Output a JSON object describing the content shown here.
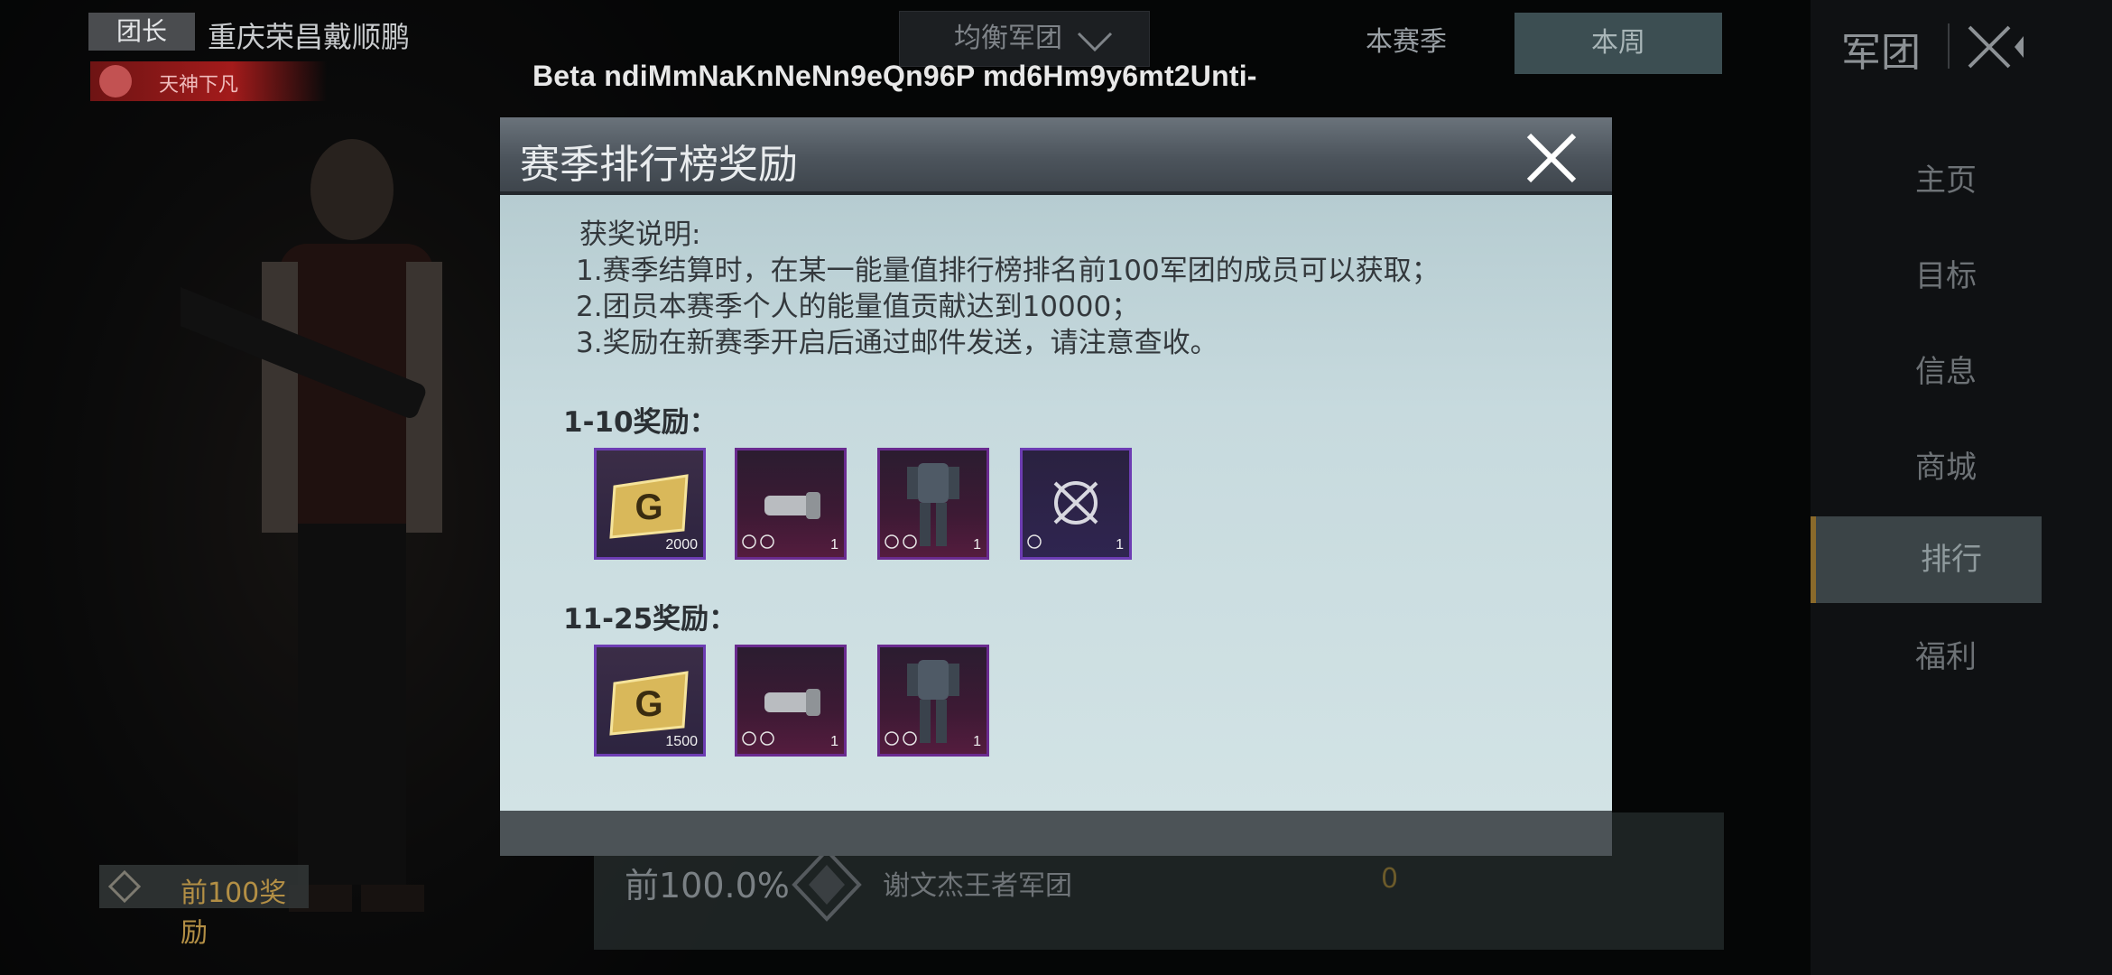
{
  "background": {
    "role_badge": "团长",
    "team_name": "重庆荣昌戴顺鹏",
    "title_ribbon": "天神下凡",
    "center_tab": "均衡军团",
    "season_tab": "本赛季",
    "week_tab": "本周",
    "panel_title": "军团",
    "nav": [
      "主页",
      "目标",
      "信息",
      "商城",
      "排行",
      "福利"
    ],
    "active_nav_index": 4,
    "rank_row": {
      "percent": "前100.0%",
      "team": "谢文杰王者军团",
      "value": "0"
    },
    "bottom_reward_label": "前100奖励"
  },
  "overlay": {
    "beta_watermark": "Beta ndiMmNaKnNeNn9eQn96P md6Hm9y6mt2Unti-"
  },
  "modal": {
    "title": "赛季排行榜奖励",
    "desc_heading": "获奖说明:",
    "desc_lines": [
      "1.赛季结算时，在某一能量值排行榜排名前100军团的成员可以获取；",
      "2.团员本赛季个人的能量值贡献达到10000；",
      "3.奖励在新赛季开启后通过邮件发送，请注意查收。"
    ],
    "sections": [
      {
        "title": "1-10奖励：",
        "items": [
          {
            "icon": "g-coin-icon",
            "count": "2000"
          },
          {
            "icon": "armband-icon",
            "count": "1"
          },
          {
            "icon": "outfit-icon",
            "count": "1"
          },
          {
            "icon": "emblem-icon",
            "count": "1"
          }
        ]
      },
      {
        "title": "11-25奖励：",
        "items": [
          {
            "icon": "g-coin-icon",
            "count": "1500"
          },
          {
            "icon": "armband-icon",
            "count": "1"
          },
          {
            "icon": "outfit-icon",
            "count": "1"
          }
        ]
      }
    ]
  },
  "colors": {
    "modal_header": "#4c545c",
    "modal_body": "#c7dade",
    "item_border": "#6a2b8f",
    "gold": "#d9b85a"
  }
}
